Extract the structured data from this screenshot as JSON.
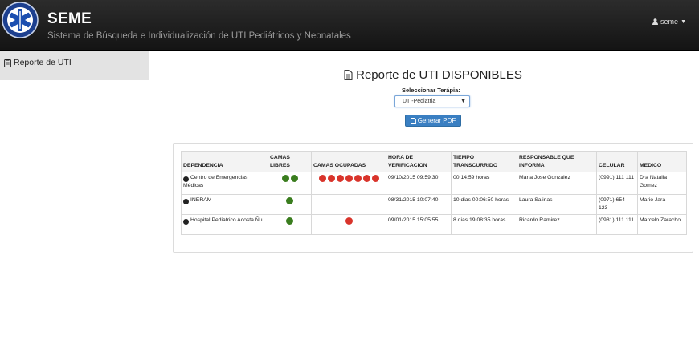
{
  "header": {
    "brand": "SEME",
    "subtitle": "Sistema de Búsqueda e Individualización de UTI Pediátricos y Neonatales",
    "user": "seme"
  },
  "sidebar": {
    "items": [
      {
        "label": "Reporte de UTI",
        "icon": "clipboard-icon"
      }
    ]
  },
  "main": {
    "title": "Reporte de UTI DISPONIBLES",
    "select_label": "Seleccionar Terápia:",
    "select_value": "UTI-Pediatria",
    "pdf_button": "Generar PDF"
  },
  "colors": {
    "free": "#3a7d1e",
    "occupied": "#d9342b",
    "button": "#3a7fc2"
  },
  "table": {
    "headers": [
      "DEPENDENCIA",
      "CAMAS LIBRES",
      "CAMAS OCUPADAS",
      "HORA DE VERIFICACION",
      "TIEMPO TRANSCURRIDO",
      "RESPONSABLE QUE INFORMA",
      "CELULAR",
      "MEDICO"
    ],
    "rows": [
      {
        "dependencia": "Centro de Emergencias Médicas",
        "libres": 2,
        "ocupadas": 7,
        "hora": "09/10/2015 09:59:30",
        "tiempo": "00:14:59 horas",
        "responsable": "Maria Jose Gonzalez",
        "celular": "(0991) 111 111",
        "medico": "Dra Natalia Gomez"
      },
      {
        "dependencia": "INERAM",
        "libres": 1,
        "ocupadas": 0,
        "hora": "08/31/2015 10:07:40",
        "tiempo": "10 dias 00:06:50 horas",
        "responsable": "Laura Salinas",
        "celular": "(0971) 654 123",
        "medico": "Mario Jara"
      },
      {
        "dependencia": "Hospital Pediatrico Acosta Ñu",
        "libres": 1,
        "ocupadas": 1,
        "hora": "09/01/2015 15:05:55",
        "tiempo": "8 dias 19:08:35 horas",
        "responsable": "Ricardo Ramirez",
        "celular": "(0981) 111 111",
        "medico": "Marcelo Zaracho"
      }
    ]
  }
}
